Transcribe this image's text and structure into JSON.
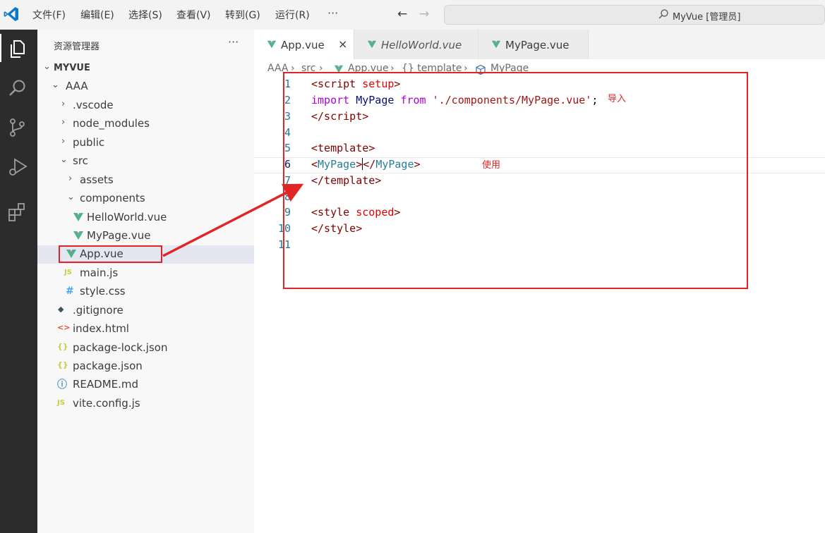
{
  "titlebar": {
    "menus": [
      "文件(F)",
      "编辑(E)",
      "选择(S)",
      "查看(V)",
      "转到(G)",
      "运行(R)"
    ],
    "more": "···",
    "back": "←",
    "forward": "→",
    "command_center_title": "MyVue [管理员]"
  },
  "activitybar": {
    "items": [
      "explorer-icon",
      "search-icon",
      "source-control-icon",
      "run-debug-icon",
      "extensions-icon"
    ]
  },
  "sidebar": {
    "title": "资源管理器",
    "more": "···",
    "tree": [
      {
        "label": "MYVUE",
        "chevron": "⌄",
        "icon": ""
      },
      {
        "label": "AAA",
        "chevron": "⌄",
        "icon": ""
      },
      {
        "label": ".vscode",
        "chevron": "›",
        "icon": ""
      },
      {
        "label": "node_modules",
        "chevron": "›",
        "icon": ""
      },
      {
        "label": "public",
        "chevron": "›",
        "icon": ""
      },
      {
        "label": "src",
        "chevron": "⌄",
        "icon": ""
      },
      {
        "label": "assets",
        "chevron": "›",
        "icon": ""
      },
      {
        "label": "components",
        "chevron": "⌄",
        "icon": ""
      },
      {
        "label": "HelloWorld.vue",
        "chevron": "",
        "icon": "vue"
      },
      {
        "label": "MyPage.vue",
        "chevron": "",
        "icon": "vue"
      },
      {
        "label": "App.vue",
        "chevron": "",
        "icon": "vue"
      },
      {
        "label": "main.js",
        "chevron": "",
        "icon": "JS"
      },
      {
        "label": "style.css",
        "chevron": "",
        "icon": "#"
      },
      {
        "label": ".gitignore",
        "chevron": "",
        "icon": "◆"
      },
      {
        "label": "index.html",
        "chevron": "",
        "icon": "<>"
      },
      {
        "label": "package-lock.json",
        "chevron": "",
        "icon": "{}"
      },
      {
        "label": "package.json",
        "chevron": "",
        "icon": "{}"
      },
      {
        "label": "README.md",
        "chevron": "",
        "icon": "ⓘ"
      },
      {
        "label": "vite.config.js",
        "chevron": "",
        "icon": "JS"
      }
    ]
  },
  "editor": {
    "tabs": [
      {
        "label": "App.vue",
        "close": "×"
      },
      {
        "label": "HelloWorld.vue"
      },
      {
        "label": "MyPage.vue"
      }
    ],
    "breadcrumb": [
      "AAA",
      "src",
      "App.vue",
      "{} template",
      "MyPage"
    ],
    "line_numbers": [
      "1",
      "2",
      "3",
      "4",
      "5",
      "6",
      "7",
      "8",
      "9",
      "10",
      "11"
    ]
  },
  "annotations": {
    "import_note": "导入",
    "use_note": "使用"
  },
  "colors": {
    "annotation": "#e12424",
    "vue_green": "#42b883",
    "activitybar_bg": "#2c2c2c"
  }
}
